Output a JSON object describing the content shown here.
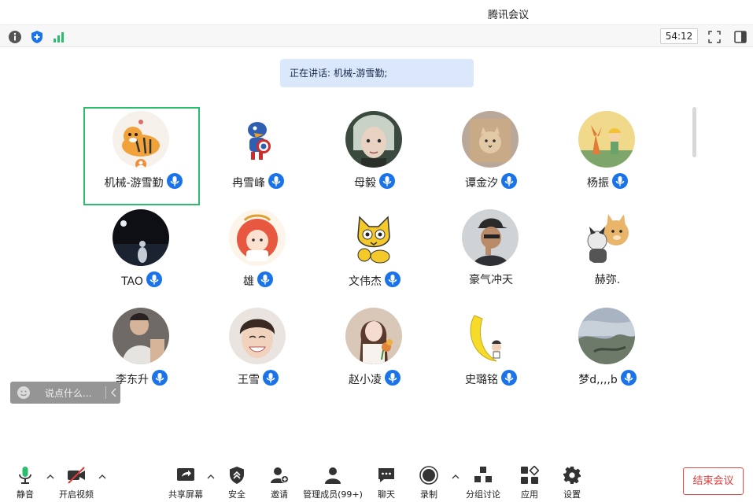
{
  "window": {
    "title": "腾讯会议"
  },
  "infobar": {
    "timer": "54:12"
  },
  "speaking": {
    "label": "正在讲话:",
    "name": "机械-游雪勤;"
  },
  "participants": [
    {
      "name": "机械-游雪勤",
      "active": true
    },
    {
      "name": "冉雪峰"
    },
    {
      "name": "母毅"
    },
    {
      "name": "谭金汐"
    },
    {
      "name": "杨振"
    },
    {
      "name": "TAO"
    },
    {
      "name": "雄"
    },
    {
      "name": "文伟杰"
    },
    {
      "name": "豪气冲天"
    },
    {
      "name": "赫弥."
    },
    {
      "name": "李东升"
    },
    {
      "name": "王雪"
    },
    {
      "name": "赵小凌"
    },
    {
      "name": "史璐铭"
    },
    {
      "name": "梦d,,,,b"
    }
  ],
  "chat_quick": {
    "placeholder": "说点什么..."
  },
  "toolbar": {
    "mute": "静音",
    "video": "开启视频",
    "share": "共享屏幕",
    "security": "安全",
    "invite": "邀请",
    "members": "管理成员(99+)",
    "chat": "聊天",
    "record": "录制",
    "breakout": "分组讨论",
    "apps": "应用",
    "settings": "设置",
    "end": "结束会议"
  },
  "colors": {
    "active_border": "#2bbd6e",
    "mic_blue": "#1a73e8",
    "end_red": "#e03a3a",
    "speaking_bg": "#dbe8fb"
  }
}
